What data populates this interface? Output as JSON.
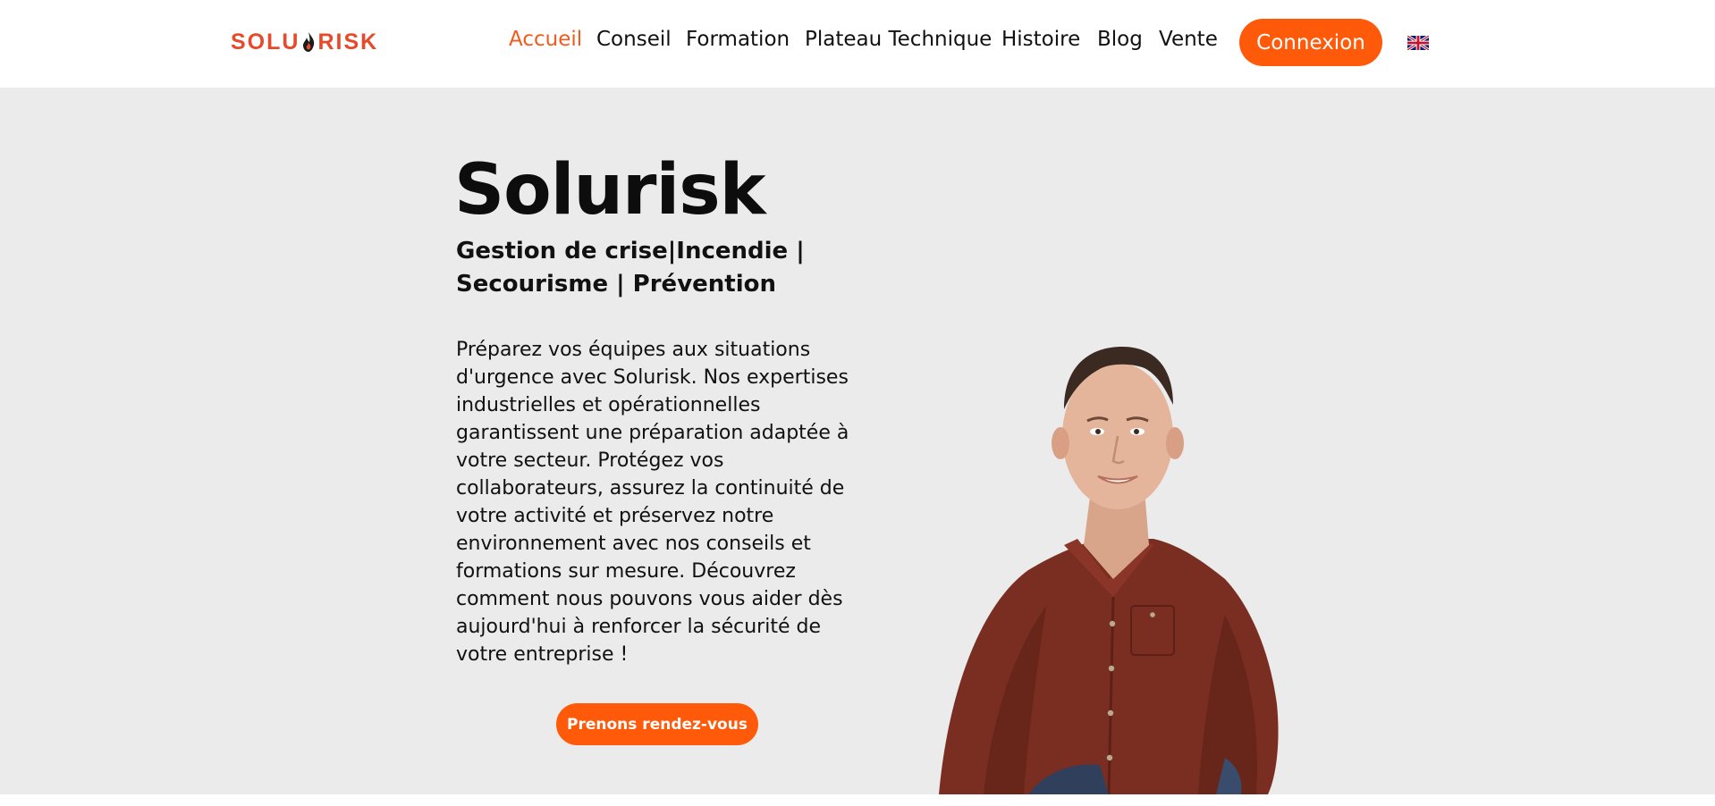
{
  "brand": {
    "logo_left": "SOLU",
    "logo_right": "RISK",
    "accent": "#ff5a0a",
    "active_nav": "#f25a1b",
    "logo_color": "#e8492b"
  },
  "nav": {
    "items": [
      {
        "label": "Accueil",
        "active": true
      },
      {
        "label": "Conseil"
      },
      {
        "label": "Formation"
      },
      {
        "label": "Plateau Technique"
      },
      {
        "label": "Histoire"
      },
      {
        "label": "Blog"
      },
      {
        "label": "Vente"
      }
    ],
    "login_label": "Connexion",
    "language_icon": "uk-flag-icon"
  },
  "hero": {
    "title": "Solurisk",
    "subtitle_line1": "Gestion de crise|Incendie |",
    "subtitle_line2": "Secourisme | Prévention",
    "body": "Préparez vos équipes aux situations d'urgence avec Solurisk. Nos expertises industrielles et opérationnelles garantissent une préparation adaptée à votre secteur. Protégez vos collaborateurs, assurez la continuité de votre activité et préservez notre environnement avec nos conseils et formations sur mesure. Découvrez comment nous pouvons vous aider dès aujourd'hui à renforcer la sécurité de votre entreprise !",
    "cta_label": "Prenons rendez-vous",
    "background": "#ebebeb"
  }
}
